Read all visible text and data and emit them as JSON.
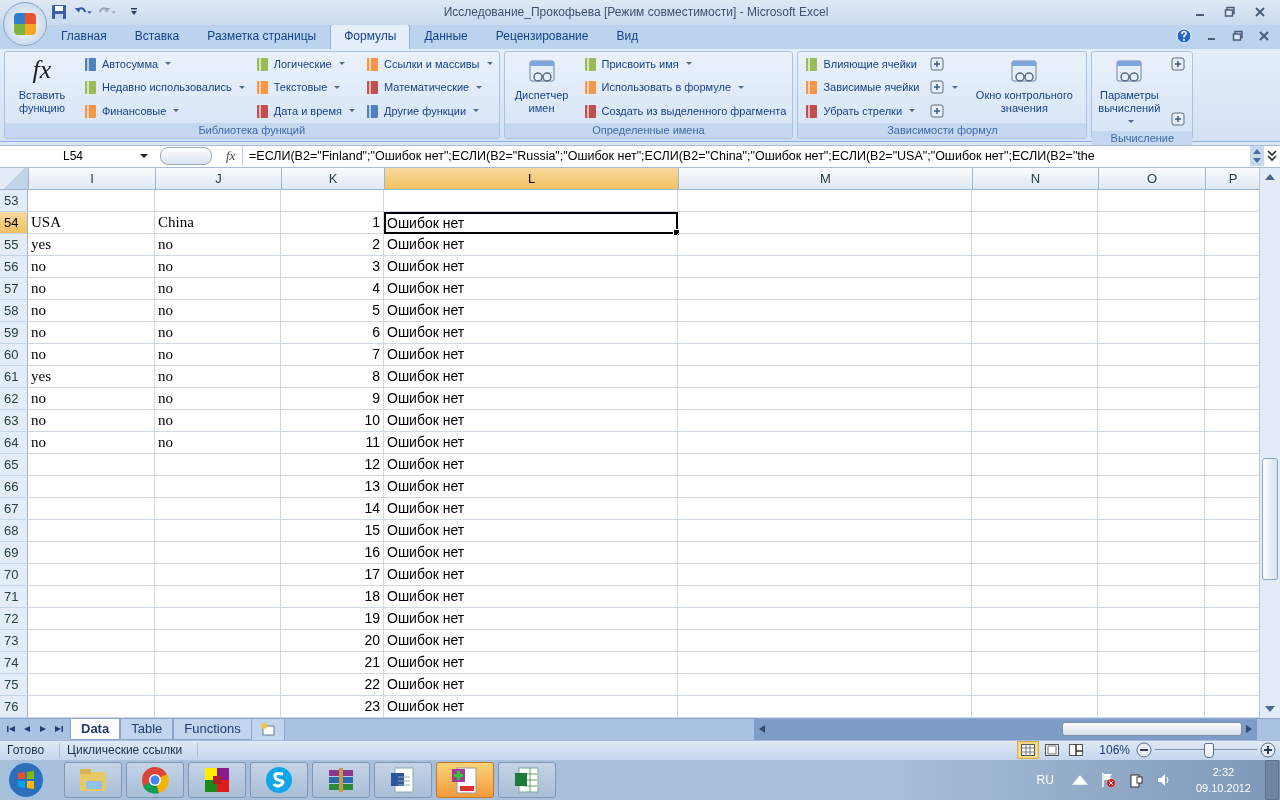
{
  "window": {
    "title": "Исследование_Прокофьева  [Режим совместимости] - Microsoft Excel"
  },
  "tabs": [
    {
      "label": "Главная",
      "selected": false
    },
    {
      "label": "Вставка",
      "selected": false
    },
    {
      "label": "Разметка страницы",
      "selected": false
    },
    {
      "label": "Формулы",
      "selected": true
    },
    {
      "label": "Данные",
      "selected": false
    },
    {
      "label": "Рецензирование",
      "selected": false
    },
    {
      "label": "Вид",
      "selected": false
    }
  ],
  "ribbon_groups": [
    {
      "title": "Библиотека функций",
      "columns": [
        {
          "items": [
            {
              "kind": "large",
              "glyph": "fx",
              "label": "Вставить функцию",
              "dropdown": false
            }
          ]
        },
        {
          "items": [
            {
              "kind": "small",
              "label": "Автосумма",
              "dropdown": true
            },
            {
              "kind": "small",
              "label": "Недавно использовались",
              "dropdown": true
            },
            {
              "kind": "small",
              "label": "Финансовые",
              "dropdown": true
            }
          ]
        },
        {
          "items": [
            {
              "kind": "small",
              "label": "Логические",
              "dropdown": true
            },
            {
              "kind": "small",
              "label": "Текстовые",
              "dropdown": true
            },
            {
              "kind": "small",
              "label": "Дата и время",
              "dropdown": true
            }
          ]
        },
        {
          "items": [
            {
              "kind": "small",
              "label": "Ссылки и массивы",
              "dropdown": true
            },
            {
              "kind": "small",
              "label": "Математические",
              "dropdown": true
            },
            {
              "kind": "small",
              "label": "Другие функции",
              "dropdown": true
            }
          ]
        }
      ]
    },
    {
      "title": "Определенные имена",
      "columns": [
        {
          "items": [
            {
              "kind": "large",
              "label": "Диспетчер имен",
              "dropdown": false
            }
          ]
        },
        {
          "items": [
            {
              "kind": "small",
              "label": "Присвоить имя",
              "dropdown": true
            },
            {
              "kind": "small",
              "label": "Использовать в формуле",
              "dropdown": true
            },
            {
              "kind": "small",
              "label": "Создать из выделенного фрагмента",
              "dropdown": false
            }
          ]
        }
      ]
    },
    {
      "title": "Зависимости формул",
      "columns": [
        {
          "items": [
            {
              "kind": "small",
              "label": "Влияющие ячейки",
              "dropdown": false
            },
            {
              "kind": "small",
              "label": "Зависимые ячейки",
              "dropdown": false
            },
            {
              "kind": "small",
              "label": "Убрать стрелки",
              "dropdown": true
            }
          ]
        },
        {
          "items": [
            {
              "kind": "icon",
              "dropdown": false
            },
            {
              "kind": "icon",
              "dropdown": true
            },
            {
              "kind": "icon",
              "dropdown": false
            }
          ]
        },
        {
          "items": [
            {
              "kind": "large",
              "label": "Окно контрольного значения",
              "dropdown": false
            }
          ]
        }
      ]
    },
    {
      "title": "Вычисление",
      "columns": [
        {
          "items": [
            {
              "kind": "large",
              "label": "Параметры вычислений",
              "dropdown": true
            }
          ]
        },
        {
          "items": [
            {
              "kind": "icon",
              "dropdown": false
            },
            {
              "kind": "icon",
              "dropdown": false
            }
          ]
        }
      ]
    }
  ],
  "formula_bar": {
    "name_box": "L54",
    "fx": "fx",
    "formula": "=ЕСЛИ(B2=\"Finland\";\"Ошибок нет\";ЕСЛИ(B2=\"Russia\";\"Ошибок нет\";ЕСЛИ(B2=\"China\";\"Ошибок нет\";ЕСЛИ(B2=\"USA\";\"Ошибок нет\";ЕСЛИ(B2=\"the"
  },
  "columns": [
    {
      "label": "I",
      "kind": "text",
      "selected": false
    },
    {
      "label": "J",
      "kind": "text",
      "selected": false
    },
    {
      "label": "K",
      "kind": "number",
      "selected": false
    },
    {
      "label": "L",
      "kind": "text",
      "selected": true
    },
    {
      "label": "M",
      "kind": "text",
      "selected": false
    },
    {
      "label": "N",
      "kind": "text",
      "selected": false
    },
    {
      "label": "O",
      "kind": "text",
      "selected": false
    },
    {
      "label": "P",
      "kind": "text",
      "selected": false
    }
  ],
  "rows": [
    {
      "number": "53",
      "selected": false,
      "cells": []
    },
    {
      "number": "54",
      "selected": true,
      "cells": [
        "USA",
        "China",
        "1",
        "Ошибок нет"
      ]
    },
    {
      "number": "55",
      "selected": false,
      "cells": [
        "yes",
        "no",
        "2",
        "Ошибок нет"
      ]
    },
    {
      "number": "56",
      "selected": false,
      "cells": [
        "no",
        "no",
        "3",
        "Ошибок нет"
      ]
    },
    {
      "number": "57",
      "selected": false,
      "cells": [
        "no",
        "no",
        "4",
        "Ошибок нет"
      ]
    },
    {
      "number": "58",
      "selected": false,
      "cells": [
        "no",
        "no",
        "5",
        "Ошибок нет"
      ]
    },
    {
      "number": "59",
      "selected": false,
      "cells": [
        "no",
        "no",
        "6",
        "Ошибок нет"
      ]
    },
    {
      "number": "60",
      "selected": false,
      "cells": [
        "no",
        "no",
        "7",
        "Ошибок нет"
      ]
    },
    {
      "number": "61",
      "selected": false,
      "cells": [
        "yes",
        "no",
        "8",
        "Ошибок нет"
      ]
    },
    {
      "number": "62",
      "selected": false,
      "cells": [
        "no",
        "no",
        "9",
        "Ошибок нет"
      ]
    },
    {
      "number": "63",
      "selected": false,
      "cells": [
        "no",
        "no",
        "10",
        "Ошибок нет"
      ]
    },
    {
      "number": "64",
      "selected": false,
      "cells": [
        "no",
        "no",
        "11",
        "Ошибок нет"
      ]
    },
    {
      "number": "65",
      "selected": false,
      "cells": [
        null,
        null,
        "12",
        "Ошибок нет"
      ]
    },
    {
      "number": "66",
      "selected": false,
      "cells": [
        null,
        null,
        "13",
        "Ошибок нет"
      ]
    },
    {
      "number": "67",
      "selected": false,
      "cells": [
        null,
        null,
        "14",
        "Ошибок нет"
      ]
    },
    {
      "number": "68",
      "selected": false,
      "cells": [
        null,
        null,
        "15",
        "Ошибок нет"
      ]
    },
    {
      "number": "69",
      "selected": false,
      "cells": [
        null,
        null,
        "16",
        "Ошибок нет"
      ]
    },
    {
      "number": "70",
      "selected": false,
      "cells": [
        null,
        null,
        "17",
        "Ошибок нет"
      ]
    },
    {
      "number": "71",
      "selected": false,
      "cells": [
        null,
        null,
        "18",
        "Ошибок нет"
      ]
    },
    {
      "number": "72",
      "selected": false,
      "cells": [
        null,
        null,
        "19",
        "Ошибок нет"
      ]
    },
    {
      "number": "73",
      "selected": false,
      "cells": [
        null,
        null,
        "20",
        "Ошибок нет"
      ]
    },
    {
      "number": "74",
      "selected": false,
      "cells": [
        null,
        null,
        "21",
        "Ошибок нет"
      ]
    },
    {
      "number": "75",
      "selected": false,
      "cells": [
        null,
        null,
        "22",
        "Ошибок нет"
      ]
    },
    {
      "number": "76",
      "selected": false,
      "cells": [
        null,
        null,
        "23",
        "Ошибок нет"
      ]
    }
  ],
  "sheet_tabs": [
    {
      "label": "Data",
      "selected": true
    },
    {
      "label": "Table",
      "selected": false
    },
    {
      "label": "Functions",
      "selected": false
    }
  ],
  "status_bar": {
    "texts": [
      "Готово",
      "Циклические ссылки"
    ],
    "views": [
      {
        "selected": true
      },
      {
        "selected": false
      },
      {
        "selected": false
      }
    ],
    "zoom": "106%",
    "zoom_slider": {
      "level": 0.52
    }
  },
  "taskbar": {
    "items": [
      {
        "kind": "folder",
        "selected": false
      },
      {
        "kind": "browser",
        "selected": false
      },
      {
        "kind": "squares",
        "selected": false
      },
      {
        "kind": "chat",
        "selected": false
      },
      {
        "kind": "archive",
        "selected": false
      },
      {
        "kind": "document",
        "selected": false
      },
      {
        "kind": "stats",
        "selected": true
      },
      {
        "kind": "spreadsheet",
        "selected": false
      }
    ],
    "language": "RU",
    "time": "2:32",
    "date": "09.10.2012"
  }
}
